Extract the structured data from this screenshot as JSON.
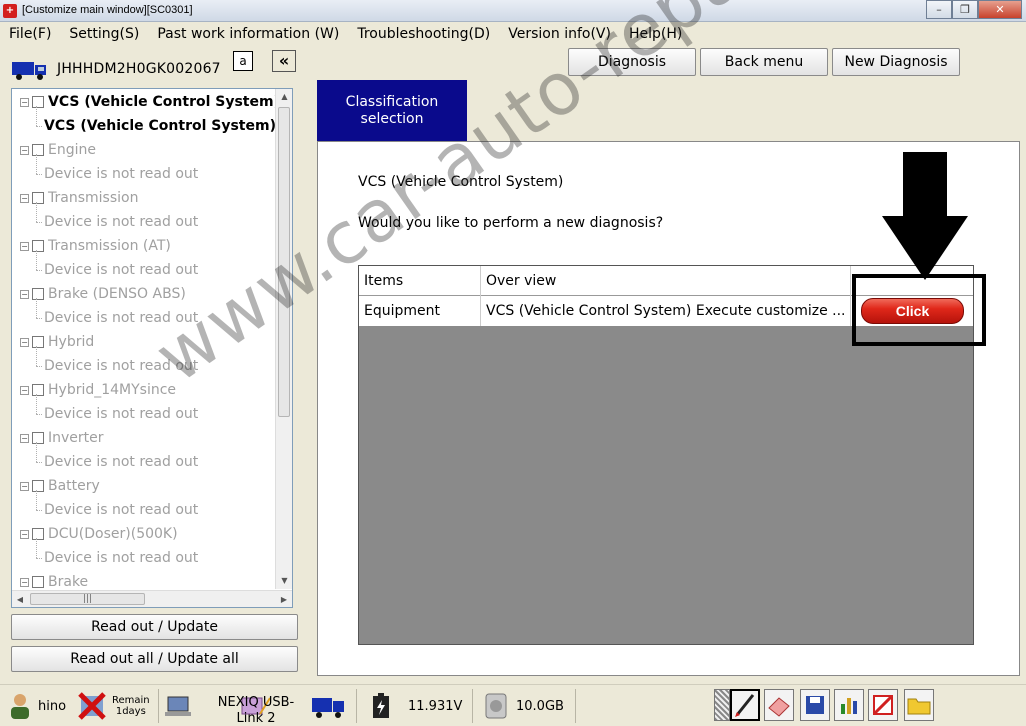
{
  "window": {
    "title": "[Customize main window][SC0301]",
    "app_icon": "+"
  },
  "menu": [
    "File(F)",
    "Setting(S)",
    "Past work information (W)",
    "Troubleshooting(D)",
    "Version info(V)",
    "Help(H)"
  ],
  "vehicle": {
    "vin": "JHHHDM2H0GK002067"
  },
  "left_controls": {
    "small_btn": "a",
    "collapse_btn": "«"
  },
  "tree": [
    {
      "label": "VCS (Vehicle Control System)",
      "type": "parent",
      "state": "bold"
    },
    {
      "label": "VCS (Vehicle Control System)",
      "type": "child",
      "state": "bold"
    },
    {
      "label": "Engine",
      "type": "parent",
      "state": "grey"
    },
    {
      "label": "Device is not read out",
      "type": "child",
      "state": "grey"
    },
    {
      "label": "Transmission",
      "type": "parent",
      "state": "grey"
    },
    {
      "label": "Device is not read out",
      "type": "child",
      "state": "grey"
    },
    {
      "label": "Transmission (AT)",
      "type": "parent",
      "state": "grey"
    },
    {
      "label": "Device is not read out",
      "type": "child",
      "state": "grey"
    },
    {
      "label": "Brake (DENSO ABS)",
      "type": "parent",
      "state": "grey"
    },
    {
      "label": "Device is not read out",
      "type": "child",
      "state": "grey"
    },
    {
      "label": "Hybrid",
      "type": "parent",
      "state": "grey"
    },
    {
      "label": "Device is not read out",
      "type": "child",
      "state": "grey"
    },
    {
      "label": "Hybrid_14MYsince",
      "type": "parent",
      "state": "grey"
    },
    {
      "label": "Device is not read out",
      "type": "child",
      "state": "grey"
    },
    {
      "label": "Inverter",
      "type": "parent",
      "state": "grey"
    },
    {
      "label": "Device is not read out",
      "type": "child",
      "state": "grey"
    },
    {
      "label": "Battery",
      "type": "parent",
      "state": "grey"
    },
    {
      "label": "Device is not read out",
      "type": "child",
      "state": "grey"
    },
    {
      "label": "DCU(Doser)(500K)",
      "type": "parent",
      "state": "grey"
    },
    {
      "label": "Device is not read out",
      "type": "child",
      "state": "grey"
    },
    {
      "label": "Brake",
      "type": "parent",
      "state": "grey"
    }
  ],
  "left_buttons": {
    "read_out": "Read out / Update",
    "read_out_all": "Read out all / Update all"
  },
  "top_buttons": {
    "diagnosis": "Diagnosis",
    "back_menu": "Back menu",
    "new_diagnosis": "New Diagnosis"
  },
  "tab": {
    "line1": "Classification",
    "line2": "selection"
  },
  "content": {
    "system": "VCS (Vehicle Control System)",
    "question": "Would you like to perform a new diagnosis?"
  },
  "grid": {
    "headers": [
      "Items",
      "Over view",
      ""
    ],
    "rows": [
      {
        "item": "Equipment",
        "overview": "VCS (Vehicle Control System) Execute customize ...",
        "button": "Click"
      }
    ]
  },
  "watermark": "www.car-auto-repair.com",
  "status": {
    "user": "hino",
    "remain_line1": "Remain",
    "remain_line2": "1days",
    "link_line1": "NEXIQ USB-",
    "link_line2": "Link 2",
    "voltage": "11.931V",
    "disk": "10.0GB"
  },
  "icons": [
    "user-icon",
    "remain-x-icon",
    "laptop-icon",
    "usb-link-icon",
    "truck-icon",
    "battery-icon",
    "disk-icon",
    "grid-tool-icon",
    "pen-icon",
    "eraser-icon",
    "save-icon",
    "chart-icon",
    "no-draw-icon",
    "folder-icon"
  ],
  "colors": {
    "tab_bg": "#0a0a8c",
    "click_btn": "#e0281a",
    "grid_bg": "#8a8a8a"
  }
}
